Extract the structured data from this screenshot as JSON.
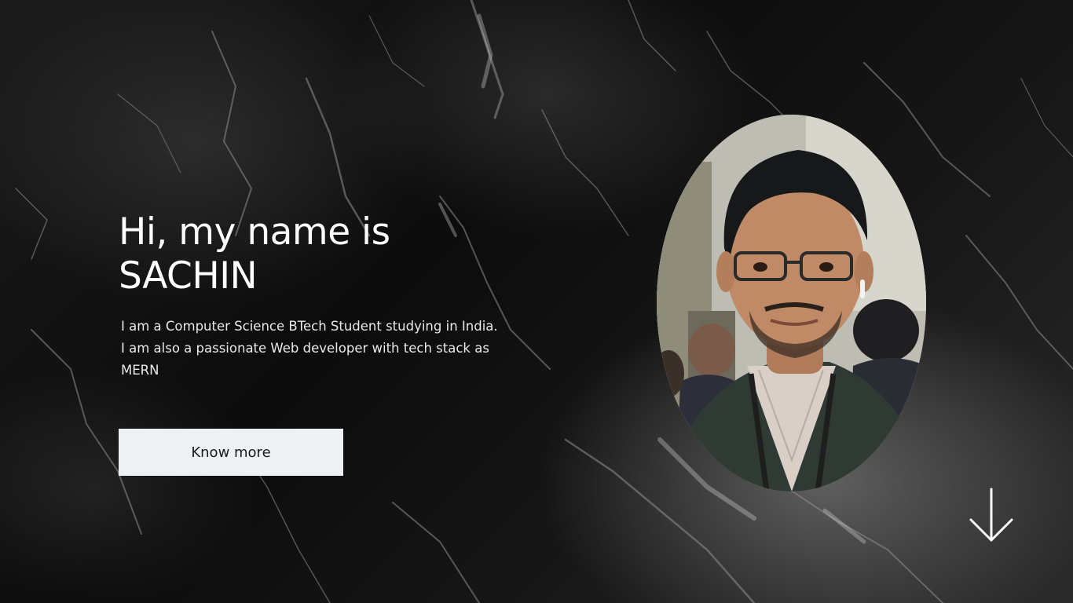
{
  "hero": {
    "title_line1": "Hi, my name is",
    "title_line2": "SACHIN",
    "description_line1": "I am a Computer Science BTech Student studying in India.",
    "description_line2": "I am also a passionate Web developer with tech stack as",
    "description_line3": "MERN",
    "cta_label": "Know more"
  },
  "portrait": {
    "alt": "SACHIN"
  },
  "icons": {
    "scroll_down": "arrow-down-icon"
  },
  "colors": {
    "background": "#0f0f0f",
    "text": "#ffffff",
    "button_bg": "#eef1f4",
    "button_text": "#1a1a1a"
  }
}
